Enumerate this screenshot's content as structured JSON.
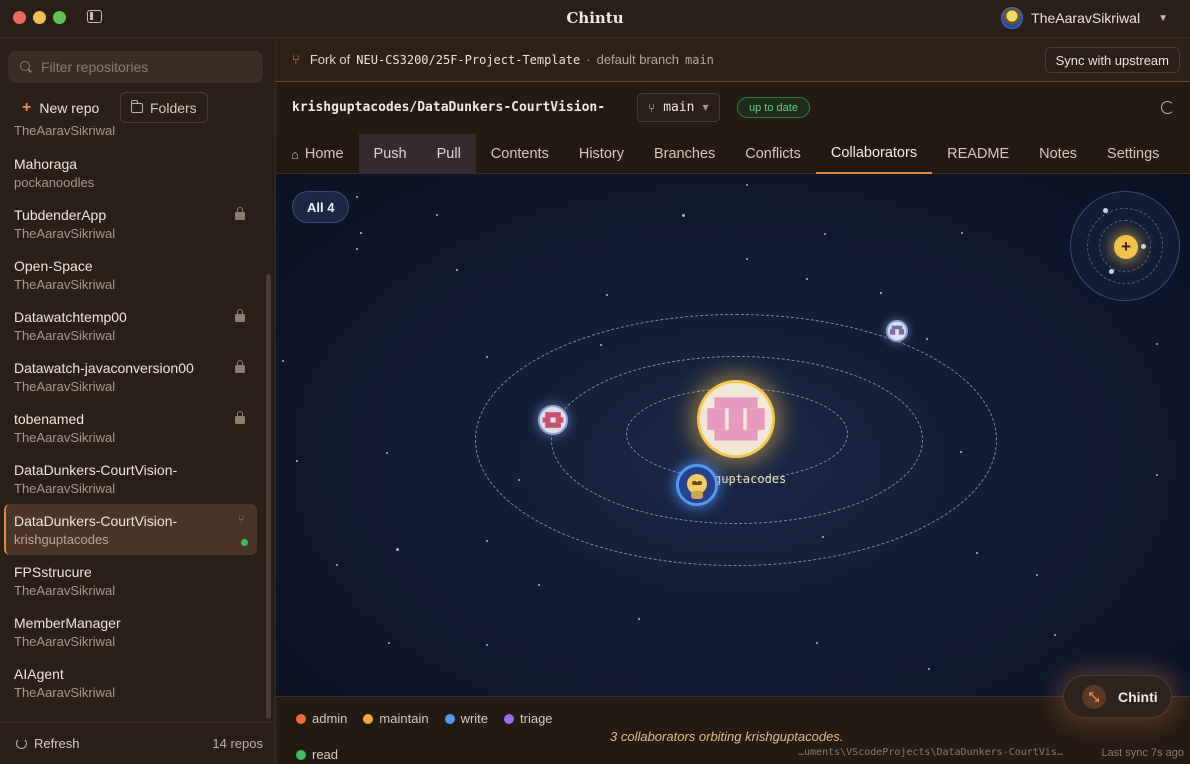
{
  "window": {
    "title": "Chintu",
    "user": "TheAaravSikriwal"
  },
  "sidebar": {
    "filter_placeholder": "Filter repositories",
    "new_repo_label": "New repo",
    "folders_label": "Folders",
    "cut_item_owner": "TheAaravSikriwal",
    "repos": [
      {
        "name": "Mahoraga",
        "owner": "pockanoodles",
        "locked": false,
        "fork": false,
        "active": false
      },
      {
        "name": "TubdenderApp",
        "owner": "TheAaravSikriwal",
        "locked": true,
        "fork": false,
        "active": false
      },
      {
        "name": "Open-Space",
        "owner": "TheAaravSikriwal",
        "locked": false,
        "fork": false,
        "active": false
      },
      {
        "name": "Datawatchtemp00",
        "owner": "TheAaravSikriwal",
        "locked": true,
        "fork": false,
        "active": false
      },
      {
        "name": "Datawatch-javaconversion00",
        "owner": "TheAaravSikriwal",
        "locked": true,
        "fork": false,
        "active": false
      },
      {
        "name": "tobenamed",
        "owner": "TheAaravSikriwal",
        "locked": true,
        "fork": false,
        "active": false
      },
      {
        "name": "DataDunkers-CourtVision-",
        "owner": "TheAaravSikriwal",
        "locked": false,
        "fork": false,
        "active": false
      },
      {
        "name": "DataDunkers-CourtVision-",
        "owner": "krishguptacodes",
        "locked": false,
        "fork": true,
        "active": true
      },
      {
        "name": "FPSstrucure",
        "owner": "TheAaravSikriwal",
        "locked": false,
        "fork": false,
        "active": false
      },
      {
        "name": "MemberManager",
        "owner": "TheAaravSikriwal",
        "locked": false,
        "fork": false,
        "active": false
      },
      {
        "name": "AIAgent",
        "owner": "TheAaravSikriwal",
        "locked": false,
        "fork": false,
        "active": false
      }
    ],
    "refresh_label": "Refresh",
    "repo_count": "14 repos"
  },
  "banner": {
    "fork_of_label": "Fork of",
    "upstream": "NEU-CS3200/25F-Project-Template",
    "separator": "·",
    "default_branch_label": "default branch",
    "default_branch": "main",
    "sync_button": "Sync with upstream"
  },
  "repo_header": {
    "full_name": "krishguptacodes/DataDunkers-CourtVision-",
    "branch": "main",
    "status": "up to date"
  },
  "tabs": [
    {
      "label": "Home",
      "icon": "home-icon"
    },
    {
      "label": "Push"
    },
    {
      "label": "Pull"
    },
    {
      "label": "Contents"
    },
    {
      "label": "History"
    },
    {
      "label": "Branches"
    },
    {
      "label": "Conflicts"
    },
    {
      "label": "Collaborators",
      "active": true
    },
    {
      "label": "README"
    },
    {
      "label": "Notes"
    },
    {
      "label": "Settings"
    }
  ],
  "collaborators_view": {
    "filter_pill": "All 4",
    "owner_label": "guptacodes",
    "caption": "3 collaborators orbiting krishguptacodes.",
    "legend": [
      {
        "label": "admin",
        "color": "#f26b3a"
      },
      {
        "label": "maintain",
        "color": "#f5a93b"
      },
      {
        "label": "write",
        "color": "#4f9cf0"
      },
      {
        "label": "triage",
        "color": "#9a6cf0"
      }
    ],
    "legend_read": {
      "label": "read",
      "color": "#3cbf5c"
    }
  },
  "status_bar": {
    "path": "…uments\\VScodeProjects\\DataDunkers-CourtVis…",
    "last_sync": "Last sync 7s ago"
  },
  "assistant_button": {
    "label": "Chinti",
    "icon": "collapse-icon"
  },
  "colors": {
    "accent": "#e8843f",
    "sun": "#f6c64d",
    "status_green": "#3cbf5c"
  }
}
